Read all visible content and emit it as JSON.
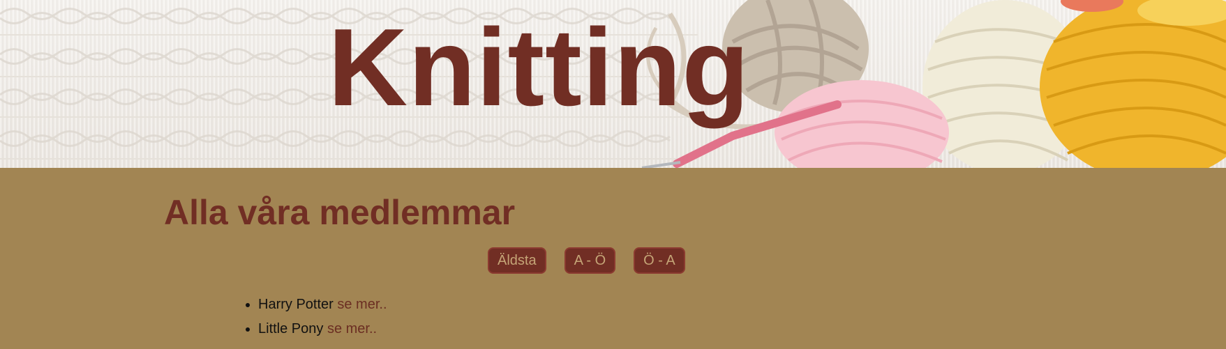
{
  "header": {
    "title": "Knitting",
    "title_color": "#712e24"
  },
  "main": {
    "heading": "Alla våra medlemmar",
    "sort_buttons": [
      {
        "label": "Äldsta"
      },
      {
        "label": "A - Ö"
      },
      {
        "label": "Ö - A"
      }
    ],
    "members": [
      {
        "name": "Harry Potter",
        "link": "se mer.."
      },
      {
        "name": "Little Pony",
        "link": "se mer.."
      }
    ]
  },
  "colors": {
    "page_background": "#a28553",
    "accent": "#712e24",
    "button_text": "#c5a577"
  }
}
